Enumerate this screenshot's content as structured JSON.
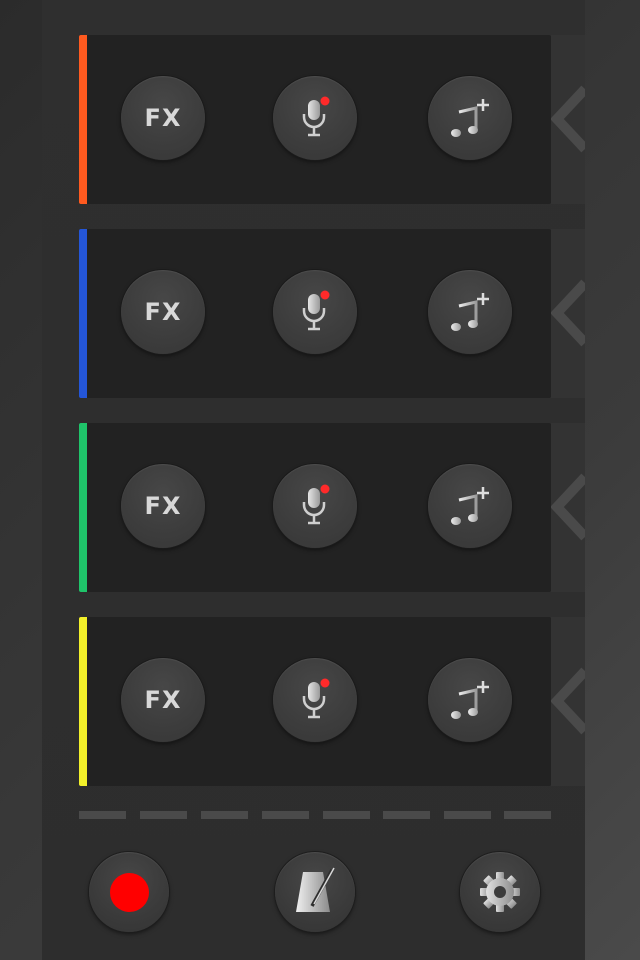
{
  "colors": {
    "track_accents": [
      "#ff5a1f",
      "#2456d8",
      "#1fc46a",
      "#f2f02a"
    ],
    "record": "#ff0000",
    "mic_indicator": "#ff2a2a"
  },
  "tracks": [
    {
      "fx_label": "FX",
      "accent": "orange"
    },
    {
      "fx_label": "FX",
      "accent": "blue"
    },
    {
      "fx_label": "FX",
      "accent": "green"
    },
    {
      "fx_label": "FX",
      "accent": "yellow"
    }
  ],
  "icons": {
    "fx": "fx-icon",
    "mic": "microphone-record-icon",
    "music": "add-music-icon",
    "chevron": "chevron-left-icon",
    "record": "record-icon",
    "metronome": "metronome-icon",
    "settings": "gear-icon"
  },
  "steps": 8
}
